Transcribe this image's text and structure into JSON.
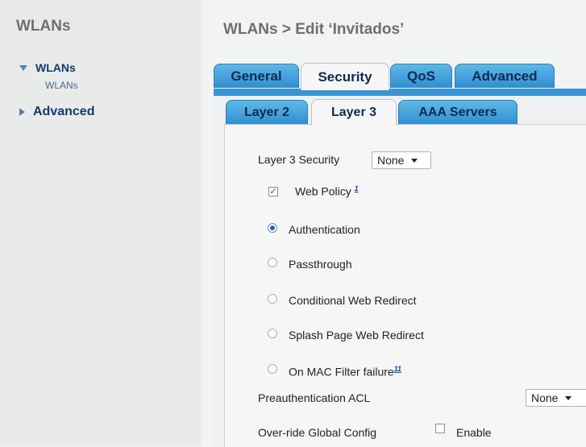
{
  "sidebar": {
    "title": "WLANs",
    "items": [
      {
        "label": "WLANs",
        "expanded": true,
        "subitems": [
          "WLANs"
        ]
      },
      {
        "label": "Advanced",
        "expanded": false
      }
    ]
  },
  "header": {
    "title": "WLANs > Edit  ‘Invitados’"
  },
  "tabs": [
    "General",
    "Security",
    "QoS",
    "Advanced"
  ],
  "active_tab": "Security",
  "subtabs": [
    "Layer 2",
    "Layer 3",
    "AAA Servers"
  ],
  "active_subtab": "Layer 3",
  "layer3": {
    "security_label": "Layer 3 Security",
    "security_value": "None",
    "web_policy_label": "Web Policy",
    "web_policy_checked": true,
    "web_policy_note": "1",
    "radios": [
      {
        "label": "Authentication",
        "selected": true
      },
      {
        "label": "Passthrough",
        "selected": false
      },
      {
        "label": "Conditional Web Redirect",
        "selected": false
      },
      {
        "label": "Splash Page Web Redirect",
        "selected": false
      },
      {
        "label": "On MAC Filter failure",
        "selected": false,
        "note": "11"
      }
    ],
    "preauth_label": "Preauthentication ACL",
    "preauth_value": "None",
    "override_label": "Over-ride Global Config",
    "override_enable_label": "Enable"
  },
  "colors": {
    "tab_blue": "#2f8ed0",
    "nav_text": "#123a6e",
    "radio_selected": "#3a5f9e"
  }
}
